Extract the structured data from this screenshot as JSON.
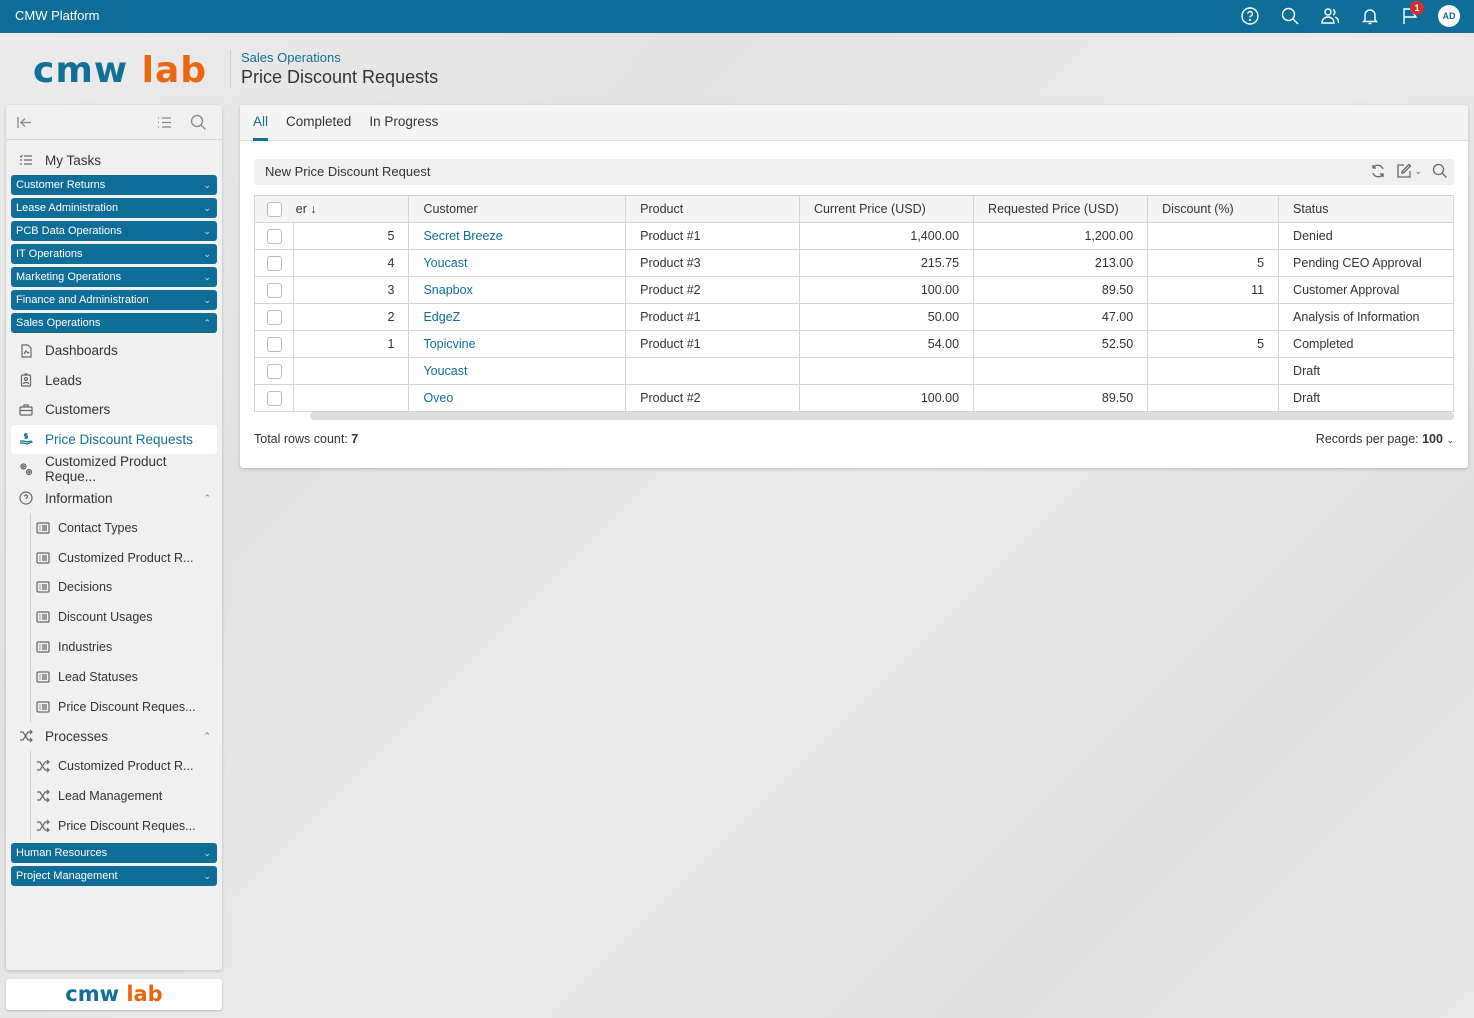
{
  "app": {
    "title": "CMW Platform",
    "logo_part1": "cmw",
    "logo_part2": "lab",
    "notification_count": "1",
    "avatar_initials": "AD"
  },
  "header": {
    "breadcrumb": "Sales Operations",
    "title": "Price Discount Requests"
  },
  "sidebar": {
    "my_tasks": "My Tasks",
    "groups_top": [
      "Customer Returns",
      "Lease Administration",
      "PCB Data Operations",
      "IT Operations",
      "Marketing Operations",
      "Finance and Administration",
      "Sales Operations"
    ],
    "items": [
      "Dashboards",
      "Leads",
      "Customers",
      "Price Discount Requests",
      "Customized Product Reque..."
    ],
    "information": {
      "label": "Information",
      "children": [
        "Contact Types",
        "Customized Product R...",
        "Decisions",
        "Discount Usages",
        "Industries",
        "Lead Statuses",
        "Price Discount Reques..."
      ]
    },
    "processes": {
      "label": "Processes",
      "children": [
        "Customized Product R...",
        "Lead Management",
        "Price Discount Reques..."
      ]
    },
    "groups_bottom": [
      "Human Resources",
      "Project Management"
    ]
  },
  "tabs": [
    "All",
    "Completed",
    "In Progress"
  ],
  "toolbar": {
    "new_label": "New Price Discount Request"
  },
  "table": {
    "columns": [
      "er ↓",
      "Customer",
      "Product",
      "Current Price (USD)",
      "Requested Price (USD)",
      "Discount (%)",
      "Status"
    ],
    "rows": [
      [
        "5",
        "Secret Breeze",
        "Product #1",
        "1,400.00",
        "1,200.00",
        "",
        "Denied"
      ],
      [
        "4",
        "Youcast",
        "Product #3",
        "215.75",
        "213.00",
        "5",
        "Pending CEO Approval"
      ],
      [
        "3",
        "Snapbox",
        "Product #2",
        "100.00",
        "89.50",
        "11",
        "Customer Approval"
      ],
      [
        "2",
        "EdgeZ",
        "Product #1",
        "50.00",
        "47.00",
        "",
        "Analysis of Information"
      ],
      [
        "1",
        "Topicvine",
        "Product #1",
        "54.00",
        "52.50",
        "5",
        "Completed"
      ],
      [
        "",
        "Youcast",
        "",
        "",
        "",
        "",
        "Draft"
      ],
      [
        "",
        "Oveo",
        "Product #2",
        "100.00",
        "89.50",
        "",
        "Draft"
      ]
    ]
  },
  "footer": {
    "total_label": "Total rows count: ",
    "total_value": "7",
    "rpp_label": "Records per page: ",
    "rpp_value": "100"
  },
  "colors": {
    "brand": "#0f6e97",
    "accent": "#e9680f",
    "badge": "#d32f2f"
  }
}
